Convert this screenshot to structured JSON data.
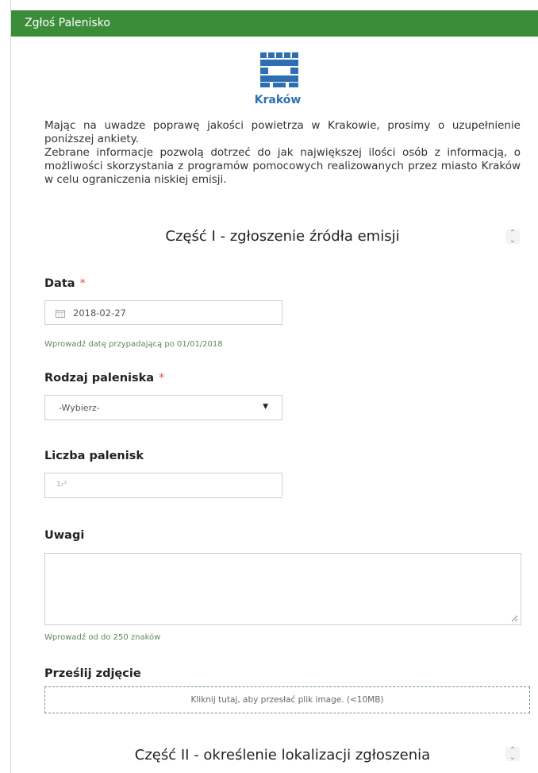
{
  "header": {
    "title": "Zgłoś Palenisko"
  },
  "brand": {
    "city_name": "Kraków",
    "accent_color": "#3c8d3a",
    "logo_color": "#2e6fb3"
  },
  "intro": {
    "line1": "Mając na uwadze poprawę jakości powietrza w Krakowie, prosimy o uzupełnienie poniższej ankiety.",
    "line2": "Zebrane informacje pozwolą dotrzeć do jak największej ilości osób z informacją, o możliwości skorzystania z programów pomocowych realizowanych przez miasto Kraków w celu ograniczenia niskiej emisji."
  },
  "section1": {
    "title": "Część I - zgłoszenie źródła emisji"
  },
  "date_field": {
    "label": "Data",
    "required_mark": "*",
    "value": "2018-02-27",
    "hint": "Wprowadź datę przypadającą po 01/01/2018"
  },
  "hearth_type": {
    "label": "Rodzaj paleniska",
    "required_mark": "*",
    "selected": "-Wybierz-"
  },
  "hearth_count": {
    "label": "Liczba palenisk",
    "placeholder_icon": "1₂³"
  },
  "notes": {
    "label": "Uwagi",
    "value": "",
    "hint": "Wprowadź od do 250 znaków"
  },
  "photo": {
    "label": "Prześlij zdjęcie",
    "upload_text": "Kliknij tutaj, aby przesłać plik image. (<10MB)"
  },
  "section2": {
    "title": "Część II - określenie lokalizacji zgłoszenia"
  }
}
